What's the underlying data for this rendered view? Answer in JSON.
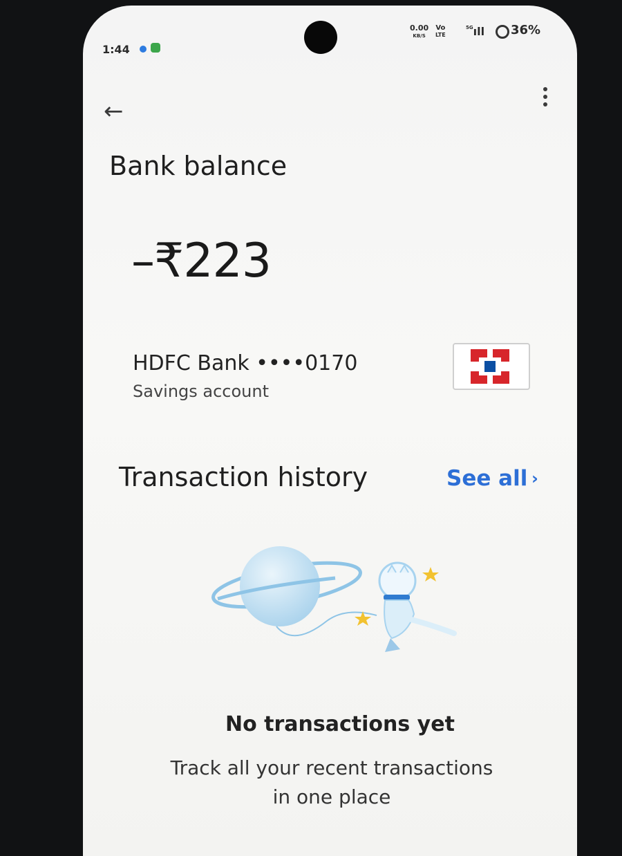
{
  "status_bar": {
    "time": "1:44",
    "net_speed_value": "0.00",
    "net_speed_unit": "KB/S",
    "network_line1": "Vo",
    "network_line2": "LTE",
    "signal_label": "5G",
    "battery": "36%"
  },
  "header": {
    "back_icon": "arrow-left-icon",
    "more_icon": "more-vert-icon"
  },
  "page": {
    "title": "Bank balance",
    "balance": "–₹223"
  },
  "account": {
    "bank_name": "HDFC Bank ••••0170",
    "account_type": "Savings account"
  },
  "transactions": {
    "title": "Transaction history",
    "see_all": "See all",
    "see_all_chevron": "›"
  },
  "empty_state": {
    "title": "No transactions yet",
    "subtitle": "Track all your recent transactions in one place"
  },
  "colors": {
    "accent": "#2d6fd6",
    "hdfc_red": "#d7262b",
    "hdfc_blue": "#0b4fa3"
  }
}
